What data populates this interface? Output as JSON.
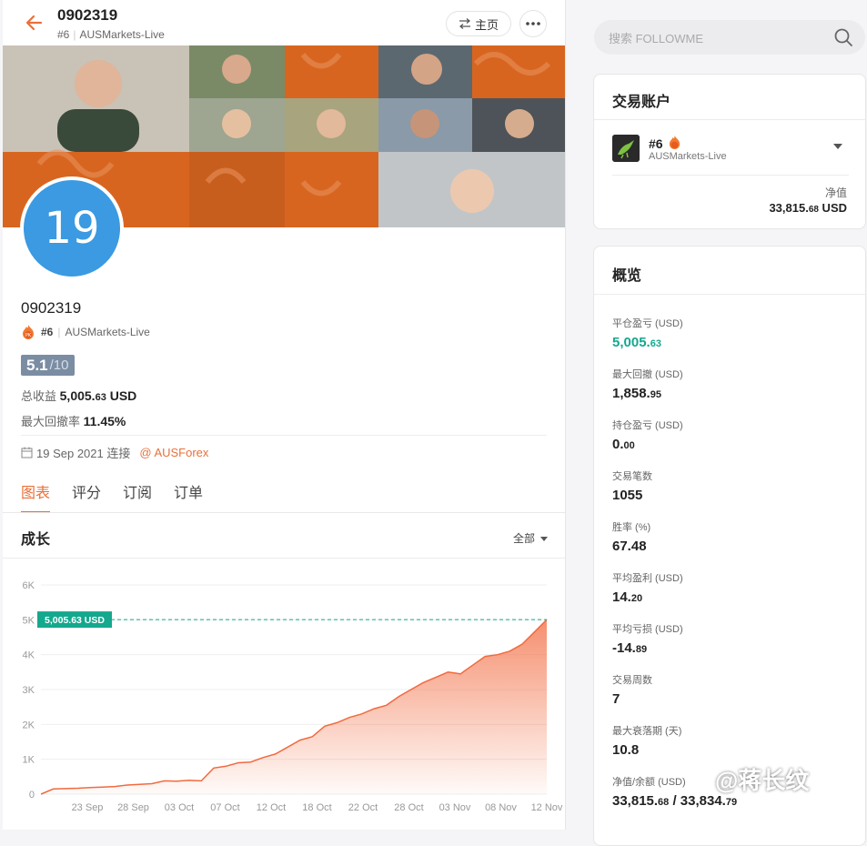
{
  "header": {
    "title": "0902319",
    "rank": "#6",
    "broker": "AUSMarkets-Live",
    "home_label": "主页"
  },
  "profile": {
    "avatar_text": "19",
    "name": "0902319",
    "rank": "#6",
    "broker": "AUSMarkets-Live",
    "score": "5.1",
    "score_max": "/10",
    "total_return_label": "总收益",
    "total_return_int": "5,005.",
    "total_return_dec": "63",
    "total_return_unit": " USD",
    "max_dd_label": "最大回撤率",
    "max_dd_value": "11.45%",
    "connect_date": "19 Sep 2021 连接",
    "connect_link": "@ AUSForex"
  },
  "tabs": [
    {
      "label": "图表"
    },
    {
      "label": "评分"
    },
    {
      "label": "订阅"
    },
    {
      "label": "订单"
    }
  ],
  "growth": {
    "title": "成长",
    "range_label": "全部"
  },
  "chart_data": {
    "type": "area",
    "title": "",
    "xlabel": "",
    "ylabel": "",
    "ylim": [
      0,
      6000
    ],
    "yticks": [
      "0",
      "1K",
      "2K",
      "3K",
      "4K",
      "5K",
      "6K"
    ],
    "xticks": [
      "23 Sep",
      "28 Sep",
      "03 Oct",
      "07 Oct",
      "12 Oct",
      "18 Oct",
      "22 Oct",
      "28 Oct",
      "03 Nov",
      "08 Nov",
      "12 Nov"
    ],
    "marker_label": "5,005.63 USD",
    "marker_value": 5005.63,
    "color": "#f26a3f",
    "series": [
      {
        "values": [
          0,
          150,
          160,
          170,
          190,
          200,
          220,
          260,
          280,
          300,
          380,
          370,
          400,
          380,
          750,
          800,
          900,
          920,
          1050,
          1150,
          1350,
          1550,
          1650,
          1950,
          2050,
          2200,
          2300,
          2450,
          2550,
          2800,
          3000,
          3200,
          3350,
          3500,
          3450,
          3700,
          3950,
          4000,
          4100,
          4300,
          4650,
          5005.63
        ]
      }
    ]
  },
  "search": {
    "placeholder": "搜索 FOLLOWME"
  },
  "account_card": {
    "title": "交易账户",
    "rank": "#6",
    "broker": "AUSMarkets-Live",
    "net_value_label": "净值",
    "net_value_int": "33,815.",
    "net_value_dec": "68",
    "net_value_unit": " USD"
  },
  "overview": {
    "title": "概览",
    "items": [
      {
        "label": "平仓盈亏 (USD)",
        "int": "5,005.",
        "dec": "63",
        "green": true
      },
      {
        "label": "最大回撤 (USD)",
        "int": "1,858.",
        "dec": "95"
      },
      {
        "label": "持仓盈亏 (USD)",
        "int": "0.",
        "dec": "00"
      },
      {
        "label": "交易笔数",
        "int": "1055",
        "dec": ""
      },
      {
        "label": "胜率 (%)",
        "int": "67.48",
        "dec": ""
      },
      {
        "label": "平均盈利 (USD)",
        "int": "14.",
        "dec": "20"
      },
      {
        "label": "平均亏损 (USD)",
        "int": "-14.",
        "dec": "89"
      },
      {
        "label": "交易周数",
        "int": "7",
        "dec": ""
      },
      {
        "label": "最大衰落期 (天)",
        "int": "10.8",
        "dec": ""
      },
      {
        "label": "净值/余额 (USD)",
        "int": "33,815.",
        "dec": "68",
        "extra_int": " / 33,834.",
        "extra_dec": "79"
      }
    ]
  },
  "watermark": "@蒋长纹",
  "colors": {
    "accent": "#e8703a",
    "green": "#14a88e",
    "avatar": "#3b9ae1"
  }
}
